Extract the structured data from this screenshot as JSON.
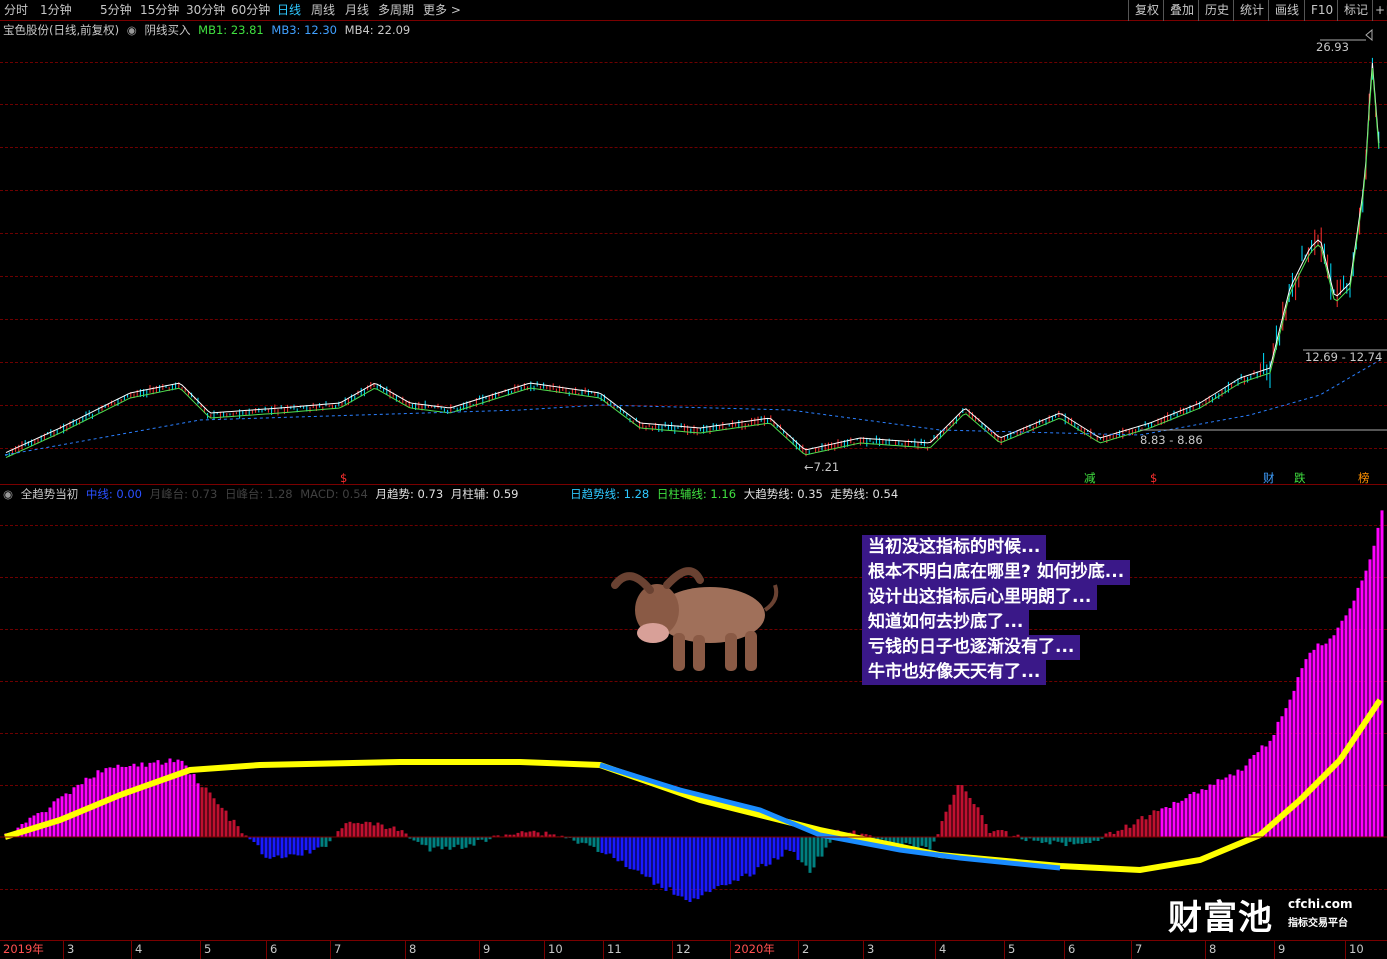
{
  "toolbar": {
    "periods": [
      "分时",
      "1分钟",
      "5分钟",
      "15分钟",
      "30分钟",
      "60分钟",
      "日线",
      "周线",
      "月线",
      "多周期",
      "更多 >"
    ],
    "active_period": "日线",
    "right_buttons": [
      "复权",
      "叠加",
      "历史",
      "统计",
      "画线",
      "F10",
      "标记",
      "+自"
    ]
  },
  "main_panel": {
    "stock_title": "宝色股份(日线,前复权)",
    "indicator_name": "阴线买入",
    "mb1": "MB1: 23.81",
    "mb3": "MB3: 12.30",
    "mb4": "MB4: 22.09",
    "labels": {
      "high": "26.93",
      "low": "7.21",
      "range1": "12.69 - 12.74",
      "range2": "8.83 - 8.86"
    },
    "markers": [
      "$",
      "减",
      "$",
      "财",
      "跌",
      "榜"
    ]
  },
  "sub_panel": {
    "indicator_name": "全趋势当初",
    "zhongxian": "中线: 0.00",
    "yuefengtai": "月峰台: 0.73",
    "rifengtai": "日峰台: 1.28",
    "macd": "MACD: 0.54",
    "yuequshi": "月趋势: 0.73",
    "yuezhufu": "月柱辅: 0.59",
    "riqushixian": "日趋势线: 1.28",
    "rizhufuxian": "日柱辅线: 1.16",
    "daqushixian": "大趋势线: 0.35",
    "zoushixian": "走势线: 0.54"
  },
  "message_lines": [
    "当初没这指标的时候...",
    "根本不明白底在哪里? 如何抄底...",
    "设计出这指标后心里明朗了...",
    "知道如何去抄底了...",
    "亏钱的日子也逐渐没有了...",
    "牛市也好像天天有了..."
  ],
  "watermark": {
    "main": "财富池",
    "url": "cfchi.com",
    "sub": "指标交易平台"
  },
  "time_axis": [
    "2019年",
    "3",
    "4",
    "5",
    "6",
    "7",
    "8",
    "9",
    "10",
    "11",
    "12",
    "2020年",
    "2",
    "3",
    "4",
    "5",
    "6",
    "7",
    "8",
    "9",
    "10"
  ],
  "colors": {
    "up": "#ff3030",
    "down": "#00e0ff",
    "ma_white": "#ffffff",
    "ma_green": "#50e050",
    "ma_blue": "#2a7fff",
    "magenta": "#ff00ff",
    "yellow": "#ffff00",
    "teal": "#008080",
    "grid": "#7a0000"
  }
}
